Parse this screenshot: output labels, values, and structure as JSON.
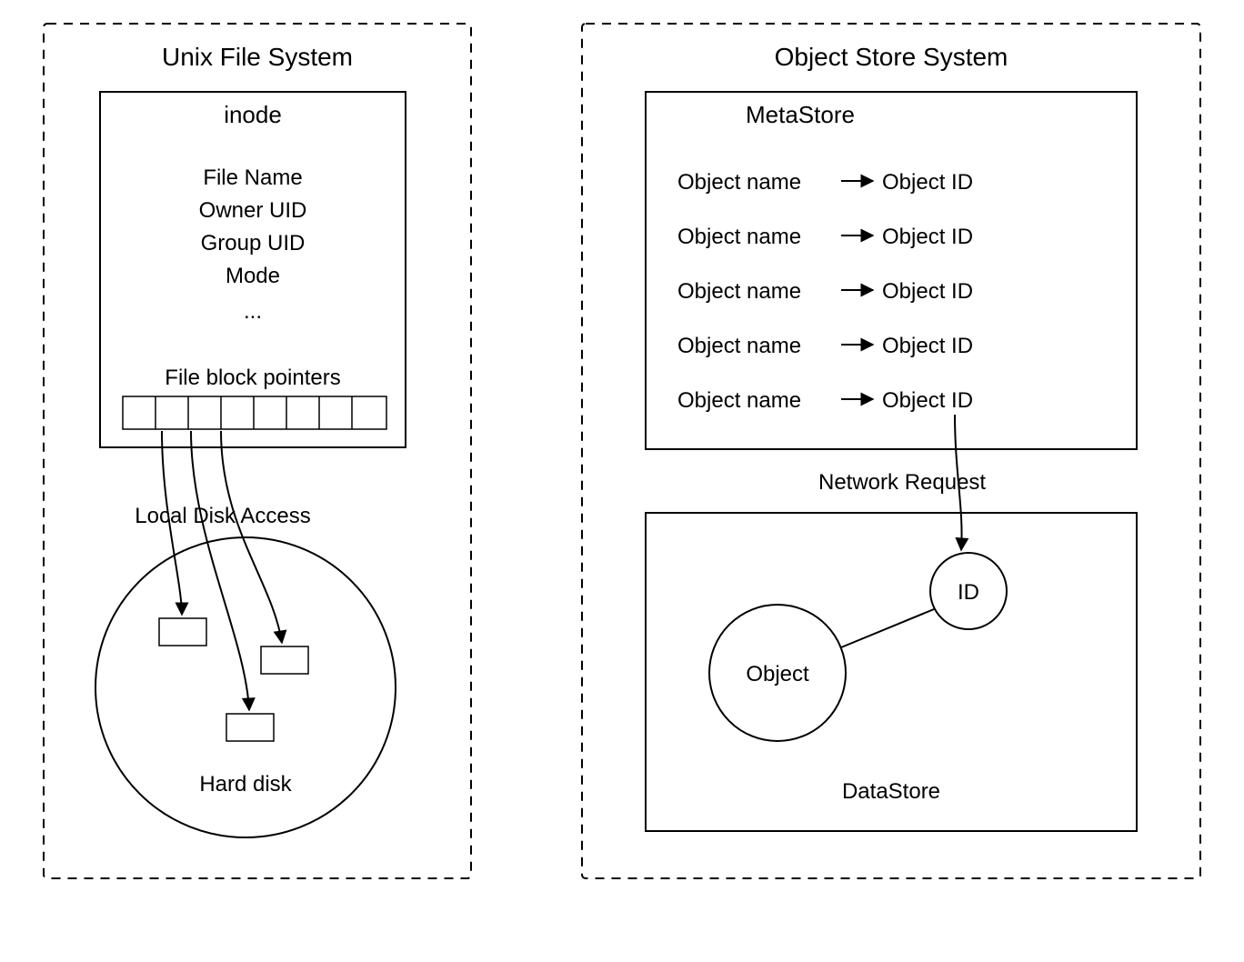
{
  "left": {
    "title": "Unix File System",
    "inode": {
      "heading": "inode",
      "fields": [
        "File Name",
        "Owner UID",
        "Group UID",
        "Mode",
        "..."
      ],
      "block_ptr_label": "File block pointers"
    },
    "access_label": "Local Disk Access",
    "disk_label": "Hard disk"
  },
  "right": {
    "title": "Object Store System",
    "metastore": {
      "heading": "MetaStore",
      "rows": [
        {
          "name": "Object name",
          "id": "Object ID"
        },
        {
          "name": "Object name",
          "id": "Object ID"
        },
        {
          "name": "Object name",
          "id": "Object ID"
        },
        {
          "name": "Object name",
          "id": "Object ID"
        },
        {
          "name": "Object name",
          "id": "Object ID"
        }
      ]
    },
    "request_label": "Network Request",
    "datastore": {
      "heading": "DataStore",
      "object_label": "Object",
      "id_label": "ID"
    }
  }
}
